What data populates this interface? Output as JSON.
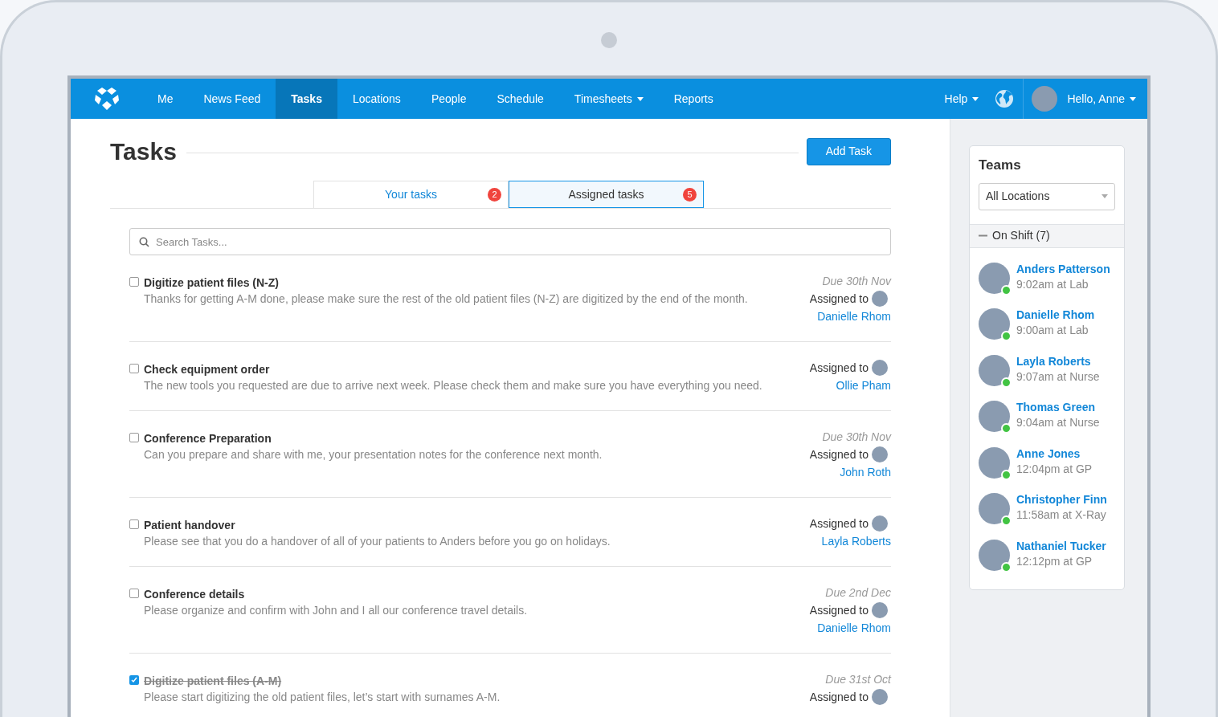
{
  "nav": {
    "items": [
      {
        "label": "Me",
        "selected": false,
        "dropdown": false
      },
      {
        "label": "News Feed",
        "selected": false,
        "dropdown": false
      },
      {
        "label": "Tasks",
        "selected": true,
        "dropdown": false
      },
      {
        "label": "Locations",
        "selected": false,
        "dropdown": false
      },
      {
        "label": "People",
        "selected": false,
        "dropdown": false
      },
      {
        "label": "Schedule",
        "selected": false,
        "dropdown": false
      },
      {
        "label": "Timesheets",
        "selected": false,
        "dropdown": true
      },
      {
        "label": "Reports",
        "selected": false,
        "dropdown": false
      }
    ],
    "help": "Help",
    "greeting": "Hello, Anne"
  },
  "page": {
    "title": "Tasks",
    "add_button": "Add Task",
    "tabs": [
      {
        "label": "Your tasks",
        "count": "2",
        "selected": false
      },
      {
        "label": "Assigned tasks",
        "count": "5",
        "selected": true
      }
    ],
    "search": {
      "placeholder": "Search Tasks..."
    },
    "tasks": [
      {
        "title": "Digitize patient files (N-Z)",
        "description": "Thanks for getting A-M done, please make sure the rest of the old patient files (N-Z) are digitized by the end of the month.",
        "due": "Due 30th Nov",
        "assigned_label": "Assigned to",
        "assignee": "Danielle Rhom",
        "checked": false
      },
      {
        "title": "Check equipment order",
        "description": "The new tools you requested are due to arrive next week. Please check them and make sure you have everything you need.",
        "assigned_label": "Assigned to",
        "assignee": "Ollie Pham",
        "checked": false
      },
      {
        "title": "Conference Preparation",
        "description": "Can you prepare and share with me, your presentation notes for the conference next month.",
        "due": "Due 30th Nov",
        "assigned_label": "Assigned to",
        "assignee": "John Roth",
        "checked": false
      },
      {
        "title": "Patient handover",
        "description": "Please see that you do a handover of all of your patients to Anders before you go on holidays.",
        "assigned_label": "Assigned to",
        "assignee": "Layla Roberts",
        "checked": false
      },
      {
        "title": "Conference details",
        "description": "Please organize and confirm with John and I all our conference travel details.",
        "due": "Due 2nd Dec",
        "assigned_label": "Assigned to",
        "assignee": "Danielle Rhom",
        "checked": false
      },
      {
        "title": "Digitize patient files (A-M)",
        "description": "Please start digitizing the old patient files, let’s start with surnames A-M.",
        "due": "Due 31st Oct",
        "assigned_label": "Assigned to",
        "checked": true
      }
    ]
  },
  "sidebar": {
    "title": "Teams",
    "location_select": "All Locations",
    "group": {
      "label": "On Shift (7)",
      "expanded": true
    },
    "people": [
      {
        "name": "Anders Patterson",
        "detail": "9:02am at Lab"
      },
      {
        "name": "Danielle Rhom",
        "detail": "9:00am at Lab"
      },
      {
        "name": "Layla Roberts",
        "detail": "9:07am at Nurse"
      },
      {
        "name": "Thomas Green",
        "detail": "9:04am at Nurse"
      },
      {
        "name": "Anne Jones",
        "detail": "12:04pm at GP"
      },
      {
        "name": "Christopher Finn",
        "detail": "11:58am at X-Ray"
      },
      {
        "name": "Nathaniel Tucker",
        "detail": "12:12pm at GP"
      }
    ]
  }
}
